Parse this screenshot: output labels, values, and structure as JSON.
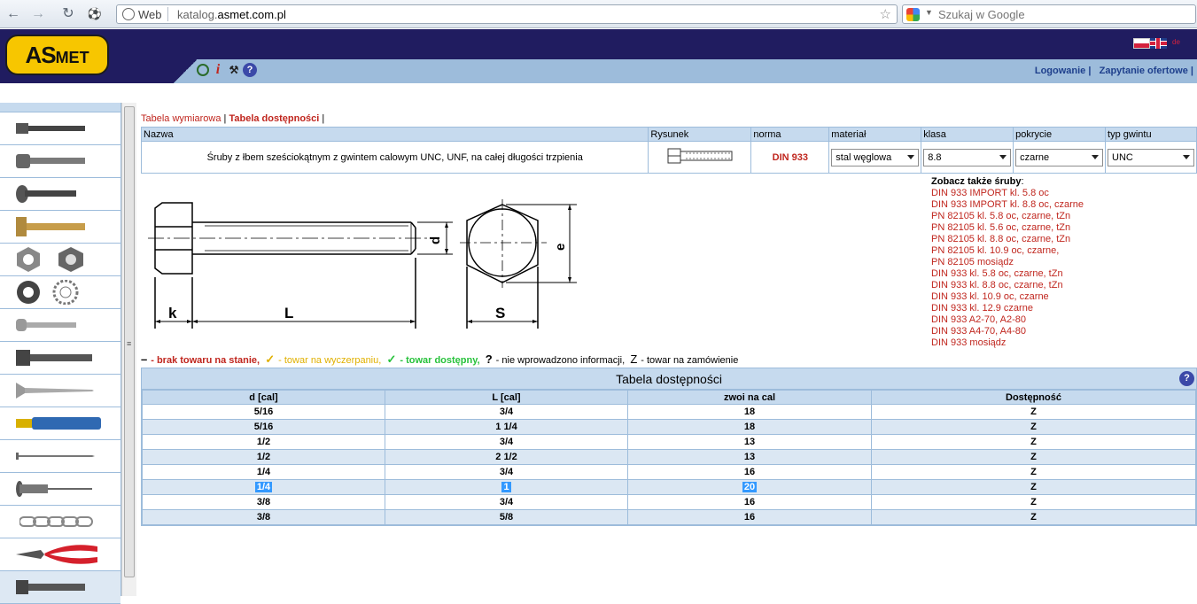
{
  "browser": {
    "web_label": "Web",
    "url_host": "katalog.",
    "url_domain": "asmet.com.pl",
    "search_placeholder": "Szukaj w Google"
  },
  "header": {
    "logo_text": "AS",
    "logo_text_small": "MET",
    "links": [
      "Logowanie",
      "Zapytanie ofertowe"
    ]
  },
  "tabs": {
    "dimensions": "Tabela wymiarowa",
    "availability": "Tabela dostępności"
  },
  "product_table": {
    "headers": [
      "Nazwa",
      "Rysunek",
      "norma",
      "materiał",
      "klasa",
      "pokrycie",
      "typ gwintu"
    ],
    "name": "Śruby z łbem sześciokątnym z gwintem calowym UNC, UNF, na całej długości trzpienia",
    "norm": "DIN 933",
    "material": "stal węglowa",
    "class": "8.8",
    "coating": "czarne",
    "thread": "UNC"
  },
  "drawing_labels": {
    "k": "k",
    "L": "L",
    "d": "d",
    "S": "S",
    "e": "e"
  },
  "see_also": {
    "title": "Zobacz także śruby",
    "colon": ":",
    "links": [
      "DIN 933 IMPORT kl. 5.8 oc",
      "DIN 933 IMPORT kl. 8.8 oc, czarne",
      "PN 82105 kl. 5.8 oc, czarne, tZn",
      "PN 82105 kl. 5.6 oc, czarne, tZn",
      "PN 82105 kl. 8.8 oc, czarne, tZn",
      "PN 82105 kl. 10.9 oc, czarne,",
      "PN 82105 mosiądz",
      "DIN 933 kl. 5.8 oc, czarne, tZn",
      "DIN 933 kl. 8.8 oc, czarne, tZn",
      "DIN 933 kl. 10.9 oc, czarne",
      "DIN 933 kl. 12.9 czarne",
      "DIN 933 A2-70, A2-80",
      "DIN 933 A4-70, A4-80",
      "DIN 933 mosiądz"
    ]
  },
  "legend": {
    "no_stock_mark": "–",
    "no_stock": "- brak towaru na stanie,",
    "low_stock_mark": "✓",
    "low_stock": "- towar na wyczerpaniu,",
    "available_mark": "✓",
    "available": "- towar dostępny,",
    "no_info_mark": "?",
    "no_info": "- nie wprowadzono informacji,",
    "on_order_mark": "Z",
    "on_order": "- towar na zamówienie"
  },
  "availability": {
    "title": "Tabela dostępności",
    "help": "?",
    "columns": [
      "d [cal]",
      "L [cal]",
      "zwoi na cal",
      "Dostępność"
    ],
    "rows": [
      [
        "5/16",
        "3/4",
        "18",
        "Z"
      ],
      [
        "5/16",
        "1 1/4",
        "18",
        "Z"
      ],
      [
        "1/2",
        "3/4",
        "13",
        "Z"
      ],
      [
        "1/2",
        "2 1/2",
        "13",
        "Z"
      ],
      [
        "1/4",
        "3/4",
        "16",
        "Z"
      ],
      [
        "1/4",
        "1",
        "20",
        "Z"
      ],
      [
        "3/8",
        "3/4",
        "16",
        "Z"
      ],
      [
        "3/8",
        "5/8",
        "16",
        "Z"
      ]
    ]
  },
  "sidebar": {
    "items": [
      "hex-bolt",
      "socket-bolt",
      "carriage-bolt",
      "t-bolt",
      "nuts",
      "washers",
      "pan-screw",
      "hex-screw",
      "wood-screw",
      "wall-plug",
      "nail",
      "rivet",
      "chain",
      "pliers",
      "bolt"
    ]
  }
}
